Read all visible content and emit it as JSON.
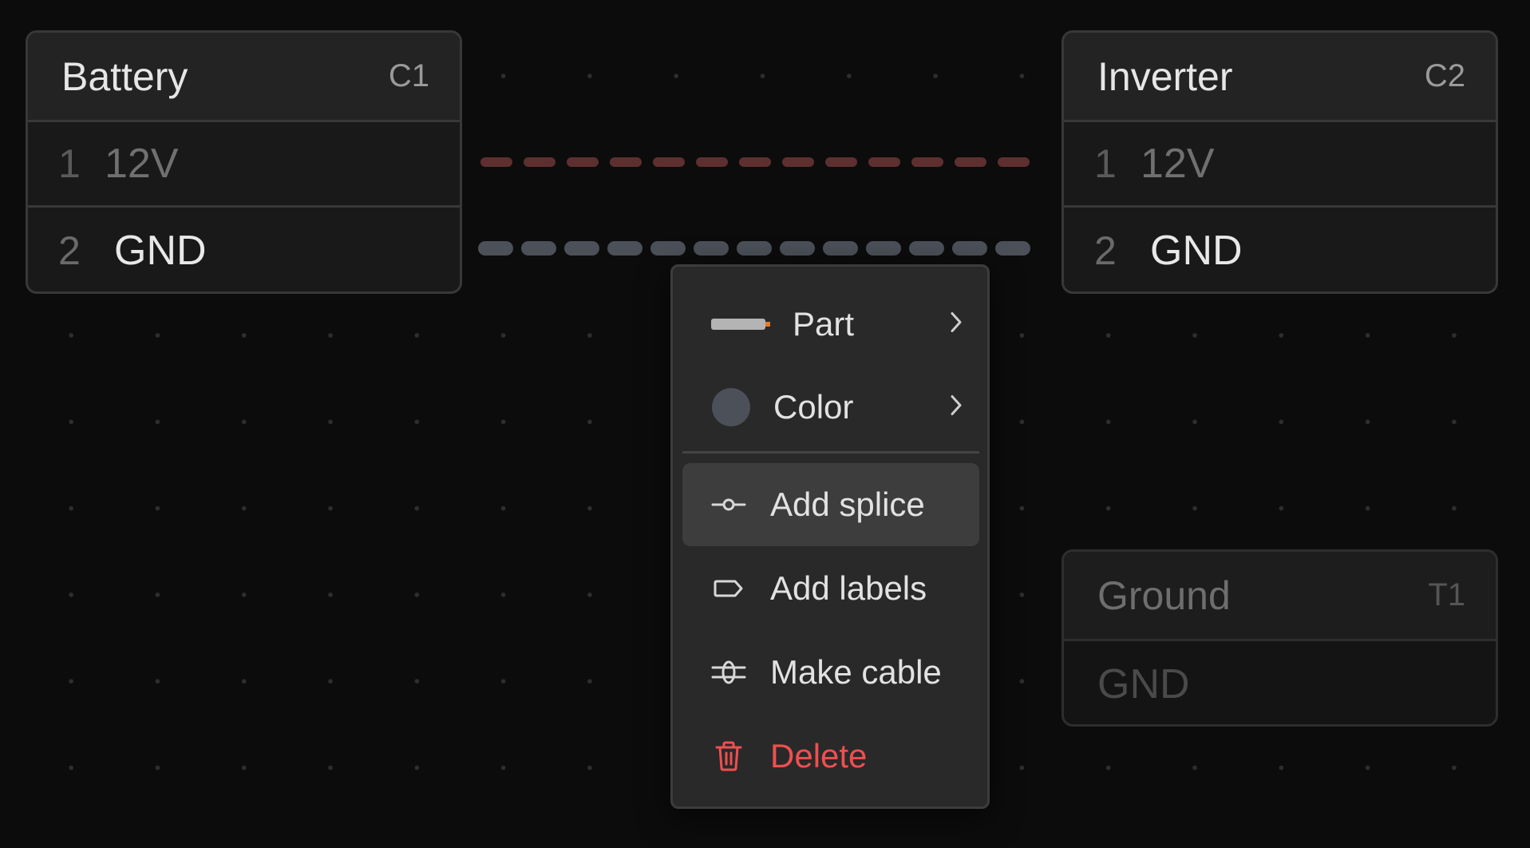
{
  "connectors": {
    "battery": {
      "title": "Battery",
      "id": "C1",
      "pins": [
        {
          "num": "1",
          "label": "12V"
        },
        {
          "num": "2",
          "label": "GND"
        }
      ]
    },
    "inverter": {
      "title": "Inverter",
      "id": "C2",
      "pins": [
        {
          "num": "1",
          "label": "12V"
        },
        {
          "num": "2",
          "label": "GND"
        }
      ]
    },
    "ground": {
      "title": "Ground",
      "id": "T1",
      "pins": [
        {
          "label": "GND"
        }
      ]
    }
  },
  "wires": {
    "wire_12v_color": "#5e2f2f",
    "wire_gnd_color": "#4b5059"
  },
  "context_menu": {
    "part": {
      "label": "Part",
      "icon": "wire-part-icon",
      "accent": "#e07b2a"
    },
    "color": {
      "label": "Color",
      "icon": "color-swatch-icon",
      "swatch": "#4b5059"
    },
    "add_splice": {
      "label": "Add splice",
      "icon": "splice-icon"
    },
    "add_labels": {
      "label": "Add labels",
      "icon": "label-tag-icon"
    },
    "make_cable": {
      "label": "Make cable",
      "icon": "cable-icon"
    },
    "delete": {
      "label": "Delete",
      "icon": "trash-icon",
      "color": "#ef4f4f"
    }
  }
}
